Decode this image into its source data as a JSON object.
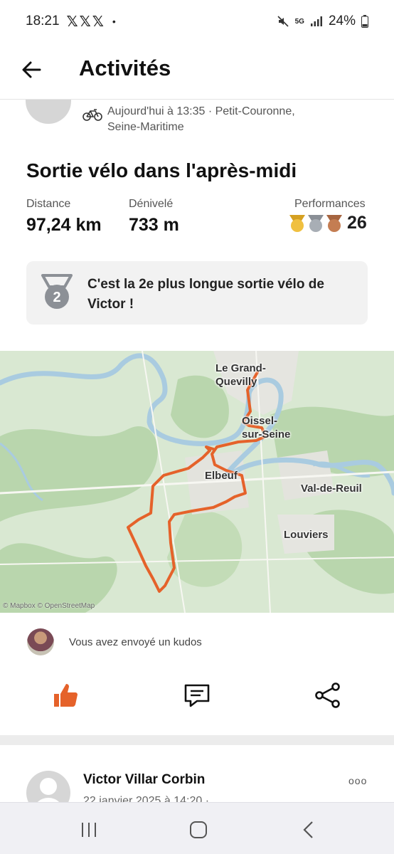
{
  "status_bar": {
    "time": "18:21",
    "notifications": "𝕏𝕏𝕏",
    "dot": "•",
    "network": "5G",
    "battery": "24%"
  },
  "header": {
    "title": "Activités",
    "back_icon": "arrow-left-icon"
  },
  "activity": {
    "meta": "Aujourd'hui à 13:35 · Petit-Couronne, Seine-Maritime",
    "sport_icon": "bike-icon",
    "title": "Sortie vélo dans l'après-midi",
    "stats": {
      "distance_label": "Distance",
      "distance_value": "97,24 km",
      "elevation_label": "Dénivelé",
      "elevation_value": "733 m",
      "performances_label": "Performances",
      "performances_value": "26"
    },
    "achievement": {
      "rank": "2",
      "text": "C'est la 2e plus longue sortie vélo de Victor !"
    },
    "map": {
      "labels": {
        "grand_quevilly": "Le Grand-\nQuevilly",
        "oissel": "Oissel-\nsur-Seine",
        "elbeuf": "Elbeuf",
        "val_de_reuil": "Val-de-Reuil",
        "louviers": "Louviers"
      },
      "attribution": "© Mapbox © OpenStreetMap",
      "route_color": "#e5622a"
    },
    "kudos": {
      "text": "Vous avez envoyé un kudos"
    },
    "actions": {
      "kudos_icon": "thumbs-up-icon",
      "comment_icon": "comment-icon",
      "share_icon": "share-icon",
      "kudos_color": "#e5622a"
    }
  },
  "next_activity": {
    "name": "Victor Villar Corbin",
    "meta": "22 janvier 2025 à 14:20 ·",
    "more_icon": "more-icon"
  },
  "nav": {
    "recents_icon": "recents-icon",
    "home_icon": "home-icon",
    "back_icon": "back-icon"
  }
}
